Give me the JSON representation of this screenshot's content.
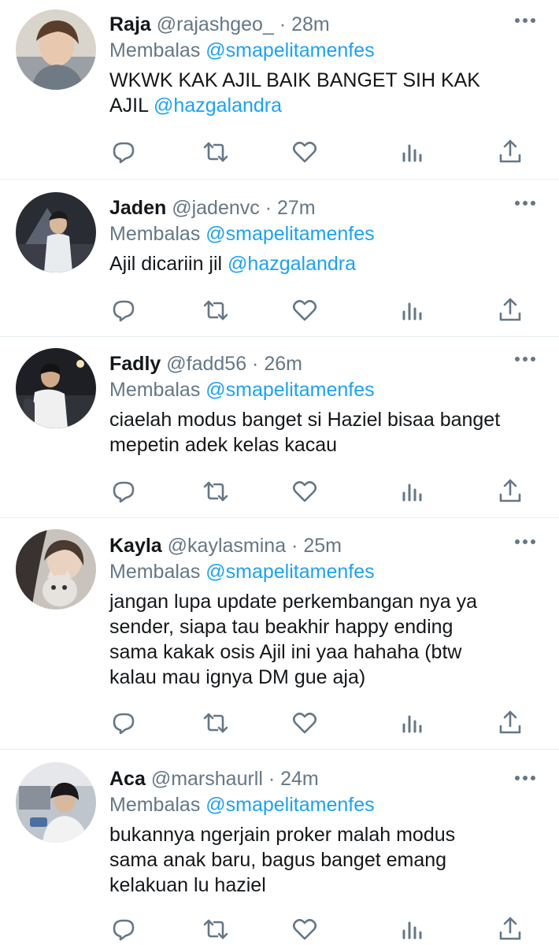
{
  "colors": {
    "text": "#14171a",
    "secondary": "#657786",
    "link": "#1da1f2",
    "divider": "#e6ecf0",
    "icon": "#657786"
  },
  "icons": {
    "reply": "reply-icon",
    "retweet": "retweet-icon",
    "like": "like-icon",
    "analytics": "analytics-icon",
    "share": "share-icon",
    "more": "more-icon"
  },
  "tweets": [
    {
      "name": "Raja",
      "handle": "@rajashgeo_",
      "sep": " · ",
      "time": "28m",
      "reply_prefix": "Membalas ",
      "reply_to": "@smapelitamenfes",
      "text": "WKWK KAK AJIL BAIK BANGET SIH KAK AJIL ",
      "mention": "@hazgalandra"
    },
    {
      "name": "Jaden",
      "handle": "@jadenvc",
      "sep": " · ",
      "time": "27m",
      "reply_prefix": "Membalas ",
      "reply_to": "@smapelitamenfes",
      "text": "Ajil dicariin jil ",
      "mention": "@hazgalandra"
    },
    {
      "name": "Fadly",
      "handle": "@fadd56",
      "sep": " · ",
      "time": "26m",
      "reply_prefix": "Membalas ",
      "reply_to": "@smapelitamenfes",
      "text": "ciaelah modus banget si Haziel bisaa banget mepetin adek kelas kacau",
      "mention": ""
    },
    {
      "name": "Kayla",
      "handle": "@kaylasmina",
      "sep": " · ",
      "time": "25m",
      "reply_prefix": "Membalas ",
      "reply_to": "@smapelitamenfes",
      "text": "jangan lupa update perkembangan nya ya sender, siapa tau beakhir happy ending sama kakak osis Ajil ini yaa hahaha (btw kalau mau ignya DM gue aja)",
      "mention": ""
    },
    {
      "name": "Aca",
      "handle": "@marshaurll",
      "sep": " · ",
      "time": "24m",
      "reply_prefix": "Membalas ",
      "reply_to": "@smapelitamenfes",
      "text": "bukannya ngerjain proker malah modus sama anak baru, bagus banget emang kelakuan lu haziel",
      "mention": ""
    }
  ]
}
